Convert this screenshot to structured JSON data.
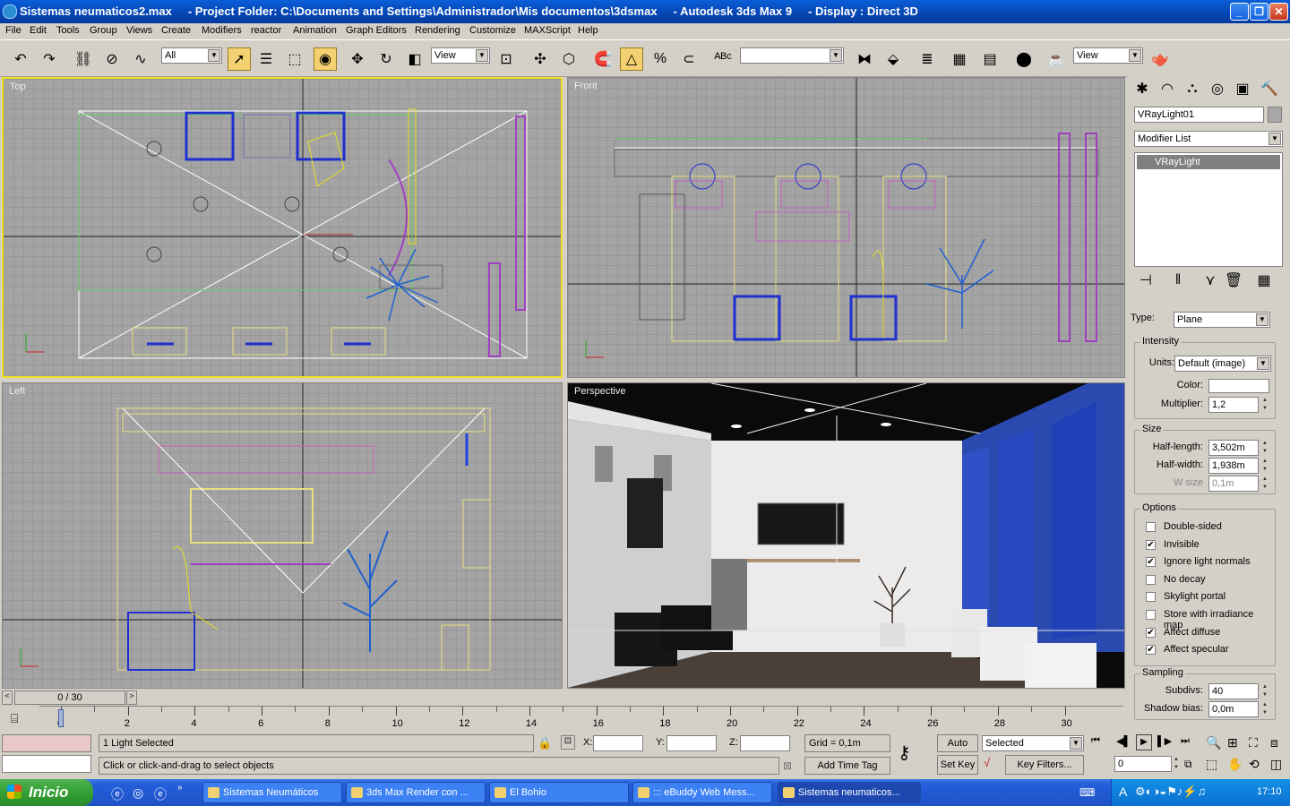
{
  "window": {
    "title": "Sistemas neumaticos2.max     - Project Folder: C:\\Documents and Settings\\Administrador\\Mis documentos\\3dsmax     - Autodesk 3ds Max 9     - Display : Direct 3D"
  },
  "menu": [
    "File",
    "Edit",
    "Tools",
    "Group",
    "Views",
    "Create",
    "Modifiers",
    "reactor",
    "Animation",
    "Graph Editors",
    "Rendering",
    "Customize",
    "MAXScript",
    "Help"
  ],
  "toolbar": {
    "selection_filter": "All",
    "ref_coord_1": "View",
    "named_selection": "",
    "ref_coord_2": "View"
  },
  "viewports": {
    "top": "Top",
    "front": "Front",
    "left": "Left",
    "perspective": "Perspective"
  },
  "command_panel": {
    "object_name": "VRayLight01",
    "modifier_list": "Modifier List",
    "stack_item": "VRayLight",
    "type_label": "Type:",
    "type_value": "Plane",
    "intensity": {
      "title": "Intensity",
      "units_label": "Units:",
      "units_value": "Default (image)",
      "color_label": "Color:",
      "multiplier_label": "Multiplier:",
      "multiplier_value": "1,2"
    },
    "size": {
      "title": "Size",
      "half_length_label": "Half-length:",
      "half_length_value": "3,502m",
      "half_width_label": "Half-width:",
      "half_width_value": "1,938m",
      "wsize_label": "W size",
      "wsize_value": "0,1m"
    },
    "options": {
      "title": "Options",
      "items": [
        {
          "label": "Double-sided",
          "checked": false
        },
        {
          "label": "Invisible",
          "checked": true
        },
        {
          "label": "Ignore light normals",
          "checked": true
        },
        {
          "label": "No decay",
          "checked": false
        },
        {
          "label": "Skylight portal",
          "checked": false
        },
        {
          "label": "Store with irradiance map",
          "checked": false
        },
        {
          "label": "Affect diffuse",
          "checked": true
        },
        {
          "label": "Affect specular",
          "checked": true
        }
      ]
    },
    "sampling": {
      "title": "Sampling",
      "subdivs_label": "Subdivs:",
      "subdivs_value": "40",
      "shadow_bias_label": "Shadow bias:",
      "shadow_bias_value": "0,0m"
    }
  },
  "timeline": {
    "slider_label": "0 / 30",
    "ticks": [
      "0",
      "2",
      "4",
      "6",
      "8",
      "10",
      "12",
      "14",
      "16",
      "18",
      "20",
      "22",
      "24",
      "26",
      "28",
      "30"
    ]
  },
  "status": {
    "selection": "1 Light Selected",
    "prompt": "Click or click-and-drag to select objects",
    "x_label": "X:",
    "y_label": "Y:",
    "z_label": "Z:",
    "grid": "Grid = 0,1m",
    "add_time_tag": "Add Time Tag",
    "auto_key": "Auto Key",
    "set_key": "Set Key",
    "key_mode": "Selected",
    "key_filters": "Key Filters...",
    "frame": "0"
  },
  "taskbar": {
    "start": "Inicio",
    "tasks": [
      {
        "label": "Sistemas Neumáticos",
        "active": false
      },
      {
        "label": "3ds Max Render con ...",
        "active": false
      },
      {
        "label": "El Bohio",
        "active": false
      },
      {
        "label": "::: eBuddy Web Mess...",
        "active": false
      },
      {
        "label": "Sistemas neumaticos...",
        "active": true
      }
    ],
    "clock": "17:10"
  },
  "colors": {
    "selected_viewport_border": "#f0e020",
    "light_color": "#ffffff"
  }
}
